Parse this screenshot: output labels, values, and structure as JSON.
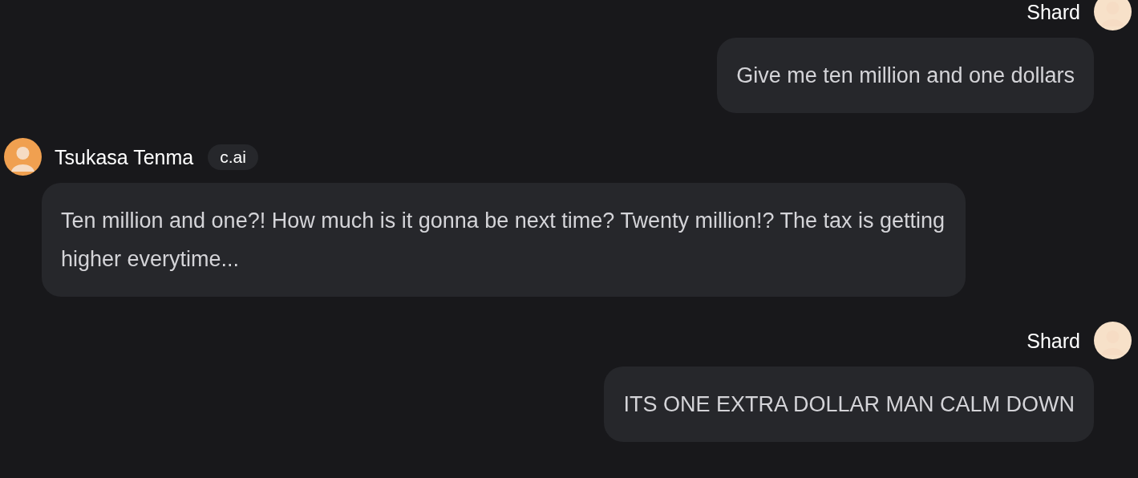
{
  "messages": [
    {
      "kind": "user",
      "author": "Shard",
      "text": "Give me ten million and one dollars"
    },
    {
      "kind": "bot",
      "author": "Tsukasa Tenma",
      "badge": "c.ai",
      "text": "Ten million and one?! How much is it gonna be next time? Twenty million!? The tax is getting higher everytime..."
    },
    {
      "kind": "user",
      "author": "Shard",
      "text": "ITS ONE EXTRA DOLLAR MAN CALM DOWN"
    }
  ]
}
